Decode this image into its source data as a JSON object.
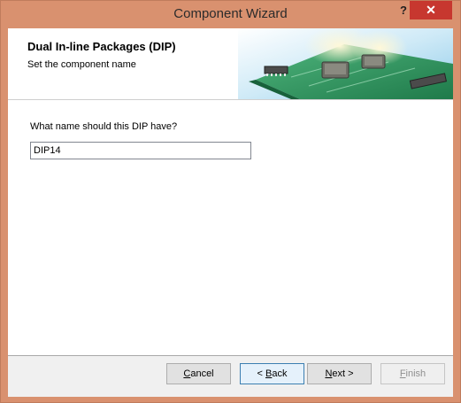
{
  "window": {
    "title": "Component Wizard",
    "help_label": "?",
    "close_label": "✕"
  },
  "header": {
    "title": "Dual In-line Packages (DIP)",
    "subtitle": "Set the component name"
  },
  "form": {
    "question": "What name should this DIP have?",
    "name_value": "DIP14"
  },
  "buttons": {
    "cancel_hotkey": "C",
    "cancel_rest": "ancel",
    "back_prefix": "< ",
    "back_hotkey": "B",
    "back_rest": "ack",
    "next_hotkey": "N",
    "next_rest": "ext >",
    "finish_hotkey": "F",
    "finish_rest": "inish"
  },
  "colors": {
    "frame": "#d9916f",
    "close": "#c7372f",
    "banner_board": "#2f9a63",
    "banner_sky": "#9fd3ee"
  },
  "icons": {
    "header_banner": "pcb-chip-banner"
  }
}
